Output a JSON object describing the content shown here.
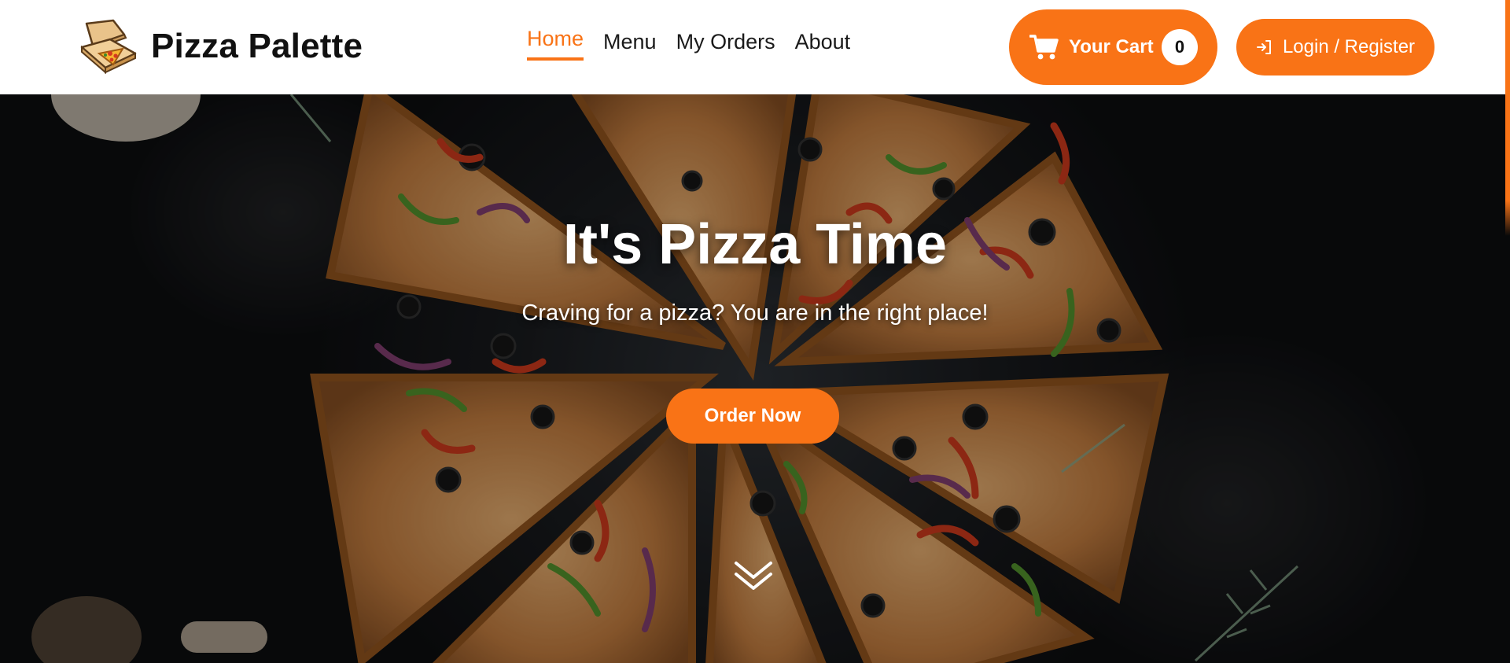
{
  "brand": {
    "name": "Pizza Palette",
    "logo_icon": "pizza-box-icon"
  },
  "nav": {
    "items": [
      {
        "label": "Home",
        "active": true
      },
      {
        "label": "Menu",
        "active": false
      },
      {
        "label": "My Orders",
        "active": false
      },
      {
        "label": "About",
        "active": false
      }
    ]
  },
  "cart": {
    "label": "Your Cart",
    "count": "0",
    "icon": "shopping-cart-icon"
  },
  "login": {
    "label": "Login / Register",
    "icon": "login-arrow-icon"
  },
  "hero": {
    "title": "It's Pizza Time",
    "subtitle": "Craving for a pizza? You are in the right place!",
    "cta_label": "Order Now",
    "scroll_icon": "double-chevron-down-icon"
  },
  "colors": {
    "accent": "#f97316",
    "header_bg": "#ffffff",
    "hero_bg": "#17191c",
    "text_dark": "#111111"
  }
}
